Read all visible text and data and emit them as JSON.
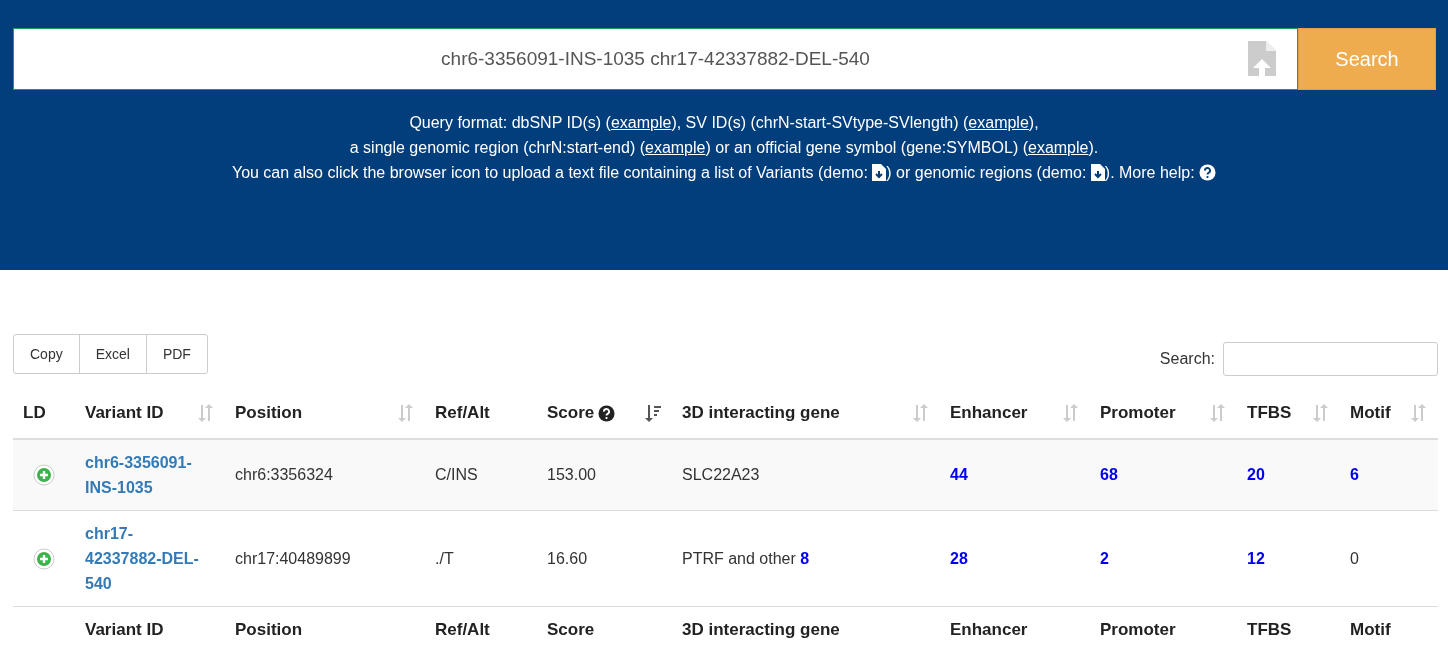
{
  "search": {
    "value": "chr6-3356091-INS-1035 chr17-42337882-DEL-540",
    "button": "Search"
  },
  "help_lines": [
    [
      {
        "kind": "text",
        "text": "Query format: dbSNP ID(s) ("
      },
      {
        "kind": "link",
        "text": "example"
      },
      {
        "kind": "text",
        "text": "), SV ID(s) (chrN-start-SVtype-SVlength) ("
      },
      {
        "kind": "link",
        "text": "example"
      },
      {
        "kind": "text",
        "text": "),"
      }
    ],
    [
      {
        "kind": "text",
        "text": "a single genomic region (chrN:start-end) ("
      },
      {
        "kind": "link",
        "text": "example"
      },
      {
        "kind": "text",
        "text": ") or an official gene symbol (gene:SYMBOL) ("
      },
      {
        "kind": "link",
        "text": "example"
      },
      {
        "kind": "text",
        "text": ")."
      }
    ],
    [
      {
        "kind": "text",
        "text": "You can also click the browser icon to upload a text file containing a list of Variants (demo: "
      },
      {
        "kind": "file"
      },
      {
        "kind": "text",
        "text": ") or genomic regions (demo: "
      },
      {
        "kind": "file"
      },
      {
        "kind": "text",
        "text": "). More help: "
      },
      {
        "kind": "help"
      }
    ]
  ],
  "export_buttons": [
    "Copy",
    "Excel",
    "PDF"
  ],
  "table_search": {
    "label": "Search:"
  },
  "columns": [
    {
      "label": "LD",
      "sortable": false,
      "help": false
    },
    {
      "label": "Variant ID",
      "sortable": true,
      "sorted_desc": false,
      "help": false
    },
    {
      "label": "Position",
      "sortable": true,
      "sorted_desc": false,
      "help": false
    },
    {
      "label": "Ref/Alt",
      "sortable": false,
      "help": false
    },
    {
      "label": "Score",
      "sortable": true,
      "sorted_desc": true,
      "help": true
    },
    {
      "label": "3D interacting gene",
      "sortable": true,
      "sorted_desc": false,
      "help": false
    },
    {
      "label": "Enhancer",
      "sortable": true,
      "sorted_desc": false,
      "help": false
    },
    {
      "label": "Promoter",
      "sortable": true,
      "sorted_desc": false,
      "help": false
    },
    {
      "label": "TFBS",
      "sortable": true,
      "sorted_desc": false,
      "help": false
    },
    {
      "label": "Motif",
      "sortable": true,
      "sorted_desc": false,
      "help": false
    }
  ],
  "rows": [
    {
      "variant_id": "chr6-3356091-INS-1035",
      "position": "chr6:3356324",
      "ref_alt": "C/INS",
      "score": "153.00",
      "gene": "SLC22A23",
      "enhancer": {
        "text": "44",
        "linked": true
      },
      "promoter": {
        "text": "68",
        "linked": true
      },
      "tfbs": {
        "text": "20",
        "linked": true
      },
      "motif": {
        "text": "6",
        "linked": true
      }
    },
    {
      "variant_id": "chr17-42337882-DEL-540",
      "position": "chr17:40489899",
      "ref_alt": "./T",
      "score": "16.60",
      "gene": "PTRF and other",
      "gene_more": "8",
      "enhancer": {
        "text": "28",
        "linked": true
      },
      "promoter": {
        "text": "2",
        "linked": true
      },
      "tfbs": {
        "text": "12",
        "linked": true
      },
      "motif": {
        "text": "0",
        "linked": false
      }
    }
  ],
  "footer_columns": [
    "Variant ID",
    "Position",
    "Ref/Alt",
    "Score",
    "3D interacting gene",
    "Enhancer",
    "Promoter",
    "TFBS",
    "Motif"
  ]
}
